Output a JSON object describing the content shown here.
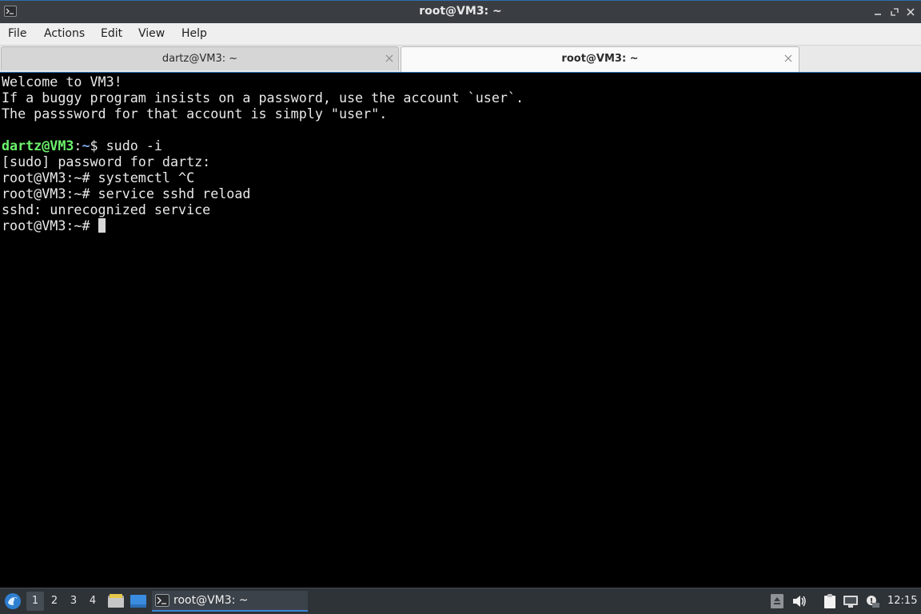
{
  "window": {
    "title": "root@VM3: ~"
  },
  "menu": [
    "File",
    "Actions",
    "Edit",
    "View",
    "Help"
  ],
  "tabs": [
    {
      "label": "dartz@VM3: ~",
      "active": false
    },
    {
      "label": "root@VM3: ~",
      "active": true
    }
  ],
  "terminal": {
    "lines": [
      "Welcome to VM3!",
      "If a buggy program insists on a password, use the account `user`.",
      "The passsword for that account is simply \"user\".",
      "",
      "",
      "[sudo] password for dartz:",
      "root@VM3:~# systemctl ^C",
      "root@VM3:~# service sshd reload",
      "sshd: unrecognized service",
      "root@VM3:~# "
    ],
    "user_prompt": {
      "user_host": "dartz@VM3",
      "colon": ":",
      "path": "~",
      "symbol": "$ ",
      "command": "sudo -i"
    }
  },
  "taskbar": {
    "workspaces": [
      "1",
      "2",
      "3",
      "4"
    ],
    "active_workspace": "1",
    "task_label": "root@VM3: ~",
    "clock": "12:15"
  },
  "icons": {
    "app": "terminal-icon",
    "start": "lxqt-menu-icon",
    "file_manager": "file-manager-icon",
    "show_desktop": "show-desktop-icon",
    "tray": [
      "scroll-up-icon",
      "volume-icon",
      "clipboard-icon",
      "network-icon",
      "notification-icon"
    ]
  },
  "colors": {
    "terminal_bg": "#000000",
    "terminal_fg": "#e9e9e9",
    "prompt_user": "#6cf26c",
    "prompt_path": "#7da7e8",
    "titlebar": "#3a3e43",
    "taskbar": "#2e3338",
    "accent": "#3a85d6"
  }
}
